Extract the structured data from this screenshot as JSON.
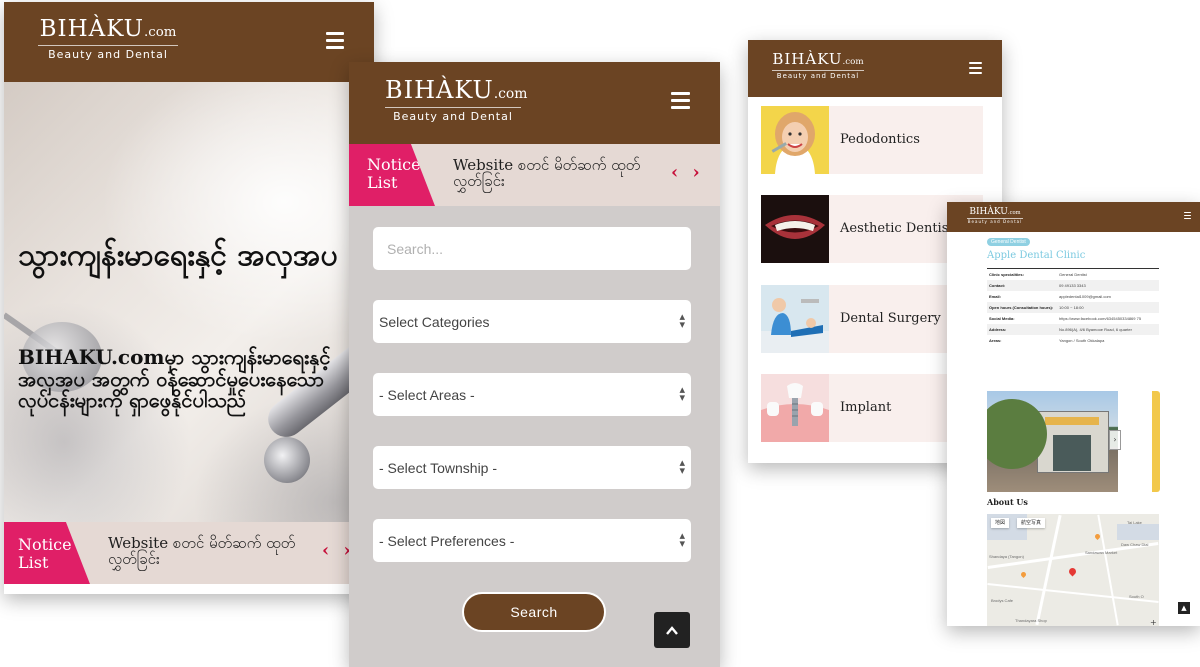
{
  "brand": {
    "name": "BIHÀKU",
    "suffix": ".com",
    "tagline": "Beauty and Dental"
  },
  "notice": {
    "label_line1": "Notice",
    "label_line2": "List",
    "text": "Website စတင် မိတ်ဆက် ထုတ်လွှတ်ခြင်း",
    "arrows": "‹ ›"
  },
  "hero": {
    "title": "သွားကျန်းမာရေးနှင့် အလှအပ",
    "subtitle": "BIHAKU.comမှာ သွားကျန်းမာရေးနှင့် အလှအပ အတွက် ဝန်ဆောင်မှုပေးနေသော လုပ်ငန်းများကို ရှာဖွေနိုင်ပါသည်"
  },
  "search": {
    "placeholder": "Search...",
    "categories": "Select Categories",
    "areas": "- Select Areas -",
    "township": "- Select Township -",
    "preferences": "- Select Preferences -",
    "button": "Search",
    "top_icon": "^"
  },
  "services": [
    {
      "name": "Pedodontics",
      "icon": "child-dental-photo"
    },
    {
      "name": "Aesthetic Dentistry",
      "icon": "smile-photo"
    },
    {
      "name": "Dental Surgery",
      "icon": "dentist-chair-photo"
    },
    {
      "name": "Implant",
      "icon": "implant-model-photo"
    }
  ],
  "clinic": {
    "badge": "General Dentist",
    "name": "Apple Dental Clinic",
    "rows": [
      {
        "k": "Clinic specialities:",
        "v": "General Dentist"
      },
      {
        "k": "Contact:",
        "v": "09 49133 3343"
      },
      {
        "k": "Email:",
        "v": "appledental1009@gmail.com"
      },
      {
        "k": "Open hours (Consultation hours):",
        "v": "10:00 ~ 18:00"
      },
      {
        "k": "Social Media:",
        "v": "https://www.facebook.com/6345450334869 75"
      },
      {
        "k": "Address:",
        "v": "No.896(A), 4/6 Byamooe Road, 6 quarter"
      },
      {
        "k": "Areas:",
        "v": "Yangon / South Okkalapa"
      }
    ],
    "about": "About Us",
    "map_tabs": [
      "地図",
      "航空写真"
    ],
    "map_labels": [
      "Tai Lake",
      "Daw Chaw Dial",
      "Sandawan Market",
      "Shandaya (Tangon)",
      "Brodys Cafe",
      "South O",
      "Thandayara Shop"
    ],
    "zoom": "+"
  },
  "colors": {
    "brown": "#6b4423",
    "notice_pink": "#e01f67",
    "notice_bg": "#e5d9d4",
    "accent_blue": "#7ccae0"
  }
}
